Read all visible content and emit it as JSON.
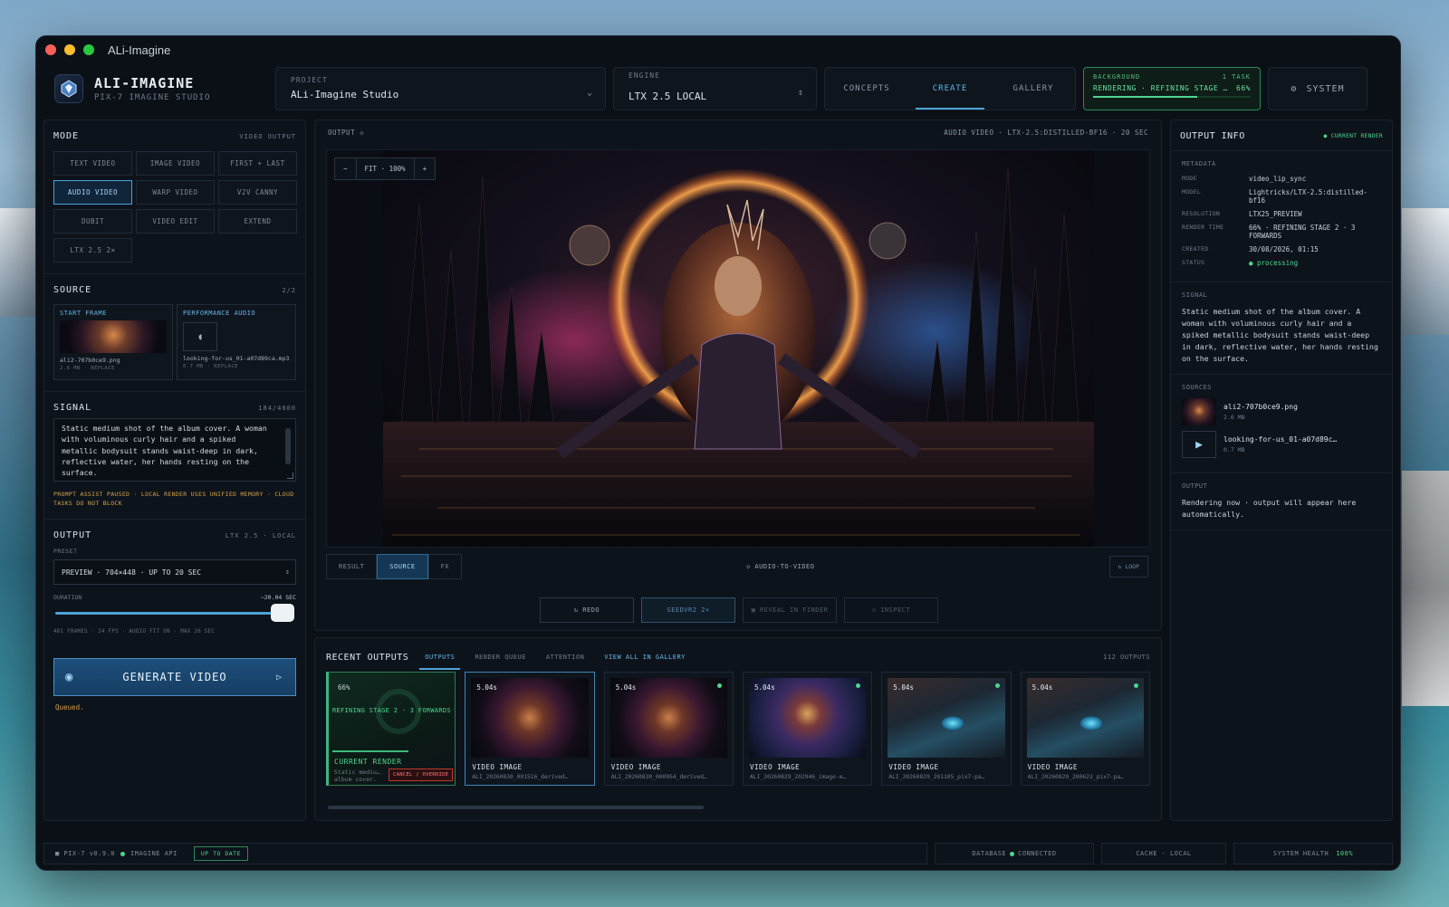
{
  "window": {
    "title": "ALi-Imagine"
  },
  "brand": {
    "name": "ALI-IMAGINE",
    "subtitle": "PIX-7 IMAGINE STUDIO"
  },
  "project": {
    "label": "PROJECT",
    "value": "ALi-Imagine Studio"
  },
  "engine": {
    "label": "ENGINE",
    "value": "LTX 2.5 LOCAL"
  },
  "nav": {
    "tabs": [
      {
        "label": "CONCEPTS"
      },
      {
        "label": "CREATE",
        "active": true
      },
      {
        "label": "GALLERY"
      }
    ]
  },
  "background_task": {
    "label": "BACKGROUND",
    "count": "1 TASK",
    "status": "RENDERING · REFINING STAGE …",
    "percent": "66%",
    "progress": 0.66
  },
  "system_button": {
    "icon": "gear-icon",
    "label": "SYSTEM"
  },
  "mode": {
    "title": "MODE",
    "meta": "VIDEO OUTPUT",
    "buttons": [
      {
        "label": "TEXT VIDEO"
      },
      {
        "label": "IMAGE VIDEO"
      },
      {
        "label": "FIRST + LAST"
      },
      {
        "label": "AUDIO VIDEO",
        "active": true
      },
      {
        "label": "WARP VIDEO"
      },
      {
        "label": "V2V CANNY"
      },
      {
        "label": "DUBIT"
      },
      {
        "label": "VIDEO EDIT"
      },
      {
        "label": "EXTEND"
      },
      {
        "label": "LTX 2.5 2×"
      }
    ]
  },
  "source": {
    "title": "SOURCE",
    "count": "2/2",
    "start_frame": {
      "label": "START FRAME",
      "file": "ali2-707b0ce9.png",
      "meta": "2.6 MB · REPLACE"
    },
    "performance_audio": {
      "label": "PERFORMANCE AUDIO",
      "file": "looking-for-us_01-a07d89ca.mp3",
      "meta": "0.7 MB · REPLACE"
    }
  },
  "signal": {
    "title": "SIGNAL",
    "count": "184/4000",
    "text": "Static medium shot of the album cover. A woman with voluminous curly hair and a spiked metallic bodysuit stands waist-deep in dark, reflective water, her hands resting on the surface.",
    "warning": "PROMPT ASSIST PAUSED · LOCAL RENDER USES UNIFIED MEMORY · CLOUD TASKS DO NOT BLOCK"
  },
  "output_settings": {
    "title": "OUTPUT",
    "meta": "LTX 2.5 · LOCAL",
    "preset_label": "PRESET",
    "preset_value": "PREVIEW · 704×448 · UP TO 20 SEC",
    "duration_label": "DURATION",
    "duration_value": "~20.04 SEC",
    "duration_fraction": 1.0,
    "note": "481 FRAMES · 24 FPS · AUDIO FIT ON · MAX 20 SEC"
  },
  "generate": {
    "label": "GENERATE VIDEO",
    "status": "Queued."
  },
  "viewer": {
    "label": "OUTPUT ◇",
    "meta": "AUDIO VIDEO · LTX-2.5:DISTILLED-BF16 · 20 SEC",
    "zoom": {
      "minus": "−",
      "value": "FIT · 100%",
      "plus": "+"
    },
    "tabs": [
      {
        "label": "RESULT"
      },
      {
        "label": "SOURCE",
        "active": true
      },
      {
        "label": "FX"
      }
    ],
    "mode_label": "◇ AUDIO-TO-VIDEO",
    "loop_label": "↻ LOOP",
    "actions": [
      {
        "label": "↻ REDO"
      },
      {
        "label": "SEEDVR2 2×"
      },
      {
        "label": "▣ REVEAL IN FINDER"
      },
      {
        "label": "◇ INSPECT"
      }
    ]
  },
  "recent": {
    "title": "RECENT OUTPUTS",
    "tabs": [
      {
        "label": "OUTPUTS",
        "active": true
      },
      {
        "label": "RENDER QUEUE"
      },
      {
        "label": "ATTENTION"
      },
      {
        "label": "VIEW ALL IN GALLERY"
      }
    ],
    "count": "112 OUTPUTS",
    "current": {
      "percent": "66%",
      "stage": "REFINING STAGE 2 · 3 FORWARDS",
      "label": "CURRENT RENDER",
      "sub": "Static mediu… album cover.",
      "cancel": "CANCEL / OVERRIDE",
      "progress": 0.66
    },
    "items": [
      {
        "duration": "5.04s",
        "type": "VIDEO IMAGE",
        "file": "ALI_20260830_001516_derived…"
      },
      {
        "duration": "5.04s",
        "type": "VIDEO IMAGE",
        "file": "ALI_20260830_000954_derived…"
      },
      {
        "duration": "5.04s",
        "type": "VIDEO IMAGE",
        "file": "ALI_20260829_202946_image-e…"
      },
      {
        "duration": "5.04s",
        "type": "VIDEO IMAGE",
        "file": "ALI_20260829_201105_pix7-pa…"
      },
      {
        "duration": "5.04s",
        "type": "VIDEO IMAGE",
        "file": "ALI_20260829_200623_pix7-pa…"
      }
    ]
  },
  "output_info": {
    "title": "OUTPUT INFO",
    "badge": "● CURRENT RENDER",
    "metadata_title": "METADATA",
    "metadata": [
      {
        "key": "MODE",
        "value": "video_lip_sync"
      },
      {
        "key": "MODEL",
        "value": "Lightricks/LTX-2.5:distilled-bf16"
      },
      {
        "key": "RESOLUTION",
        "value": "LTX25_PREVIEW"
      },
      {
        "key": "RENDER TIME",
        "value": "66% · REFINING STAGE 2 · 3 FORWARDS"
      },
      {
        "key": "CREATED",
        "value": "30/08/2026, 01:15"
      },
      {
        "key": "STATUS",
        "value": "● processing"
      }
    ],
    "signal_title": "SIGNAL",
    "signal_text": "Static medium shot of the album cover. A woman with voluminous curly hair and a spiked metallic bodysuit stands waist-deep in dark, reflective water, her hands resting on the surface.",
    "sources_title": "SOURCES",
    "sources": [
      {
        "name": "ali2-707b0ce9.png",
        "size": "2.6 MB"
      },
      {
        "name": "looking-for-us_01-a07d89c…",
        "size": "0.7 MB"
      }
    ],
    "output_title": "OUTPUT",
    "output_text": "Rendering now · output will appear here automatically."
  },
  "statusbar": {
    "version": "■ PIX-7 v0.9.0",
    "api": "IMAGINE API",
    "up_to_date": "UP TO DATE",
    "database_label": "DATABASE",
    "database_value": "CONNECTED",
    "cache": "CACHE · LOCAL",
    "health_label": "SYSTEM HEALTH",
    "health_value": "100%"
  },
  "colors": {
    "accent": "#4da3d8",
    "success": "#4fd68e",
    "warning": "#d3a24a",
    "danger": "#c0392b"
  }
}
